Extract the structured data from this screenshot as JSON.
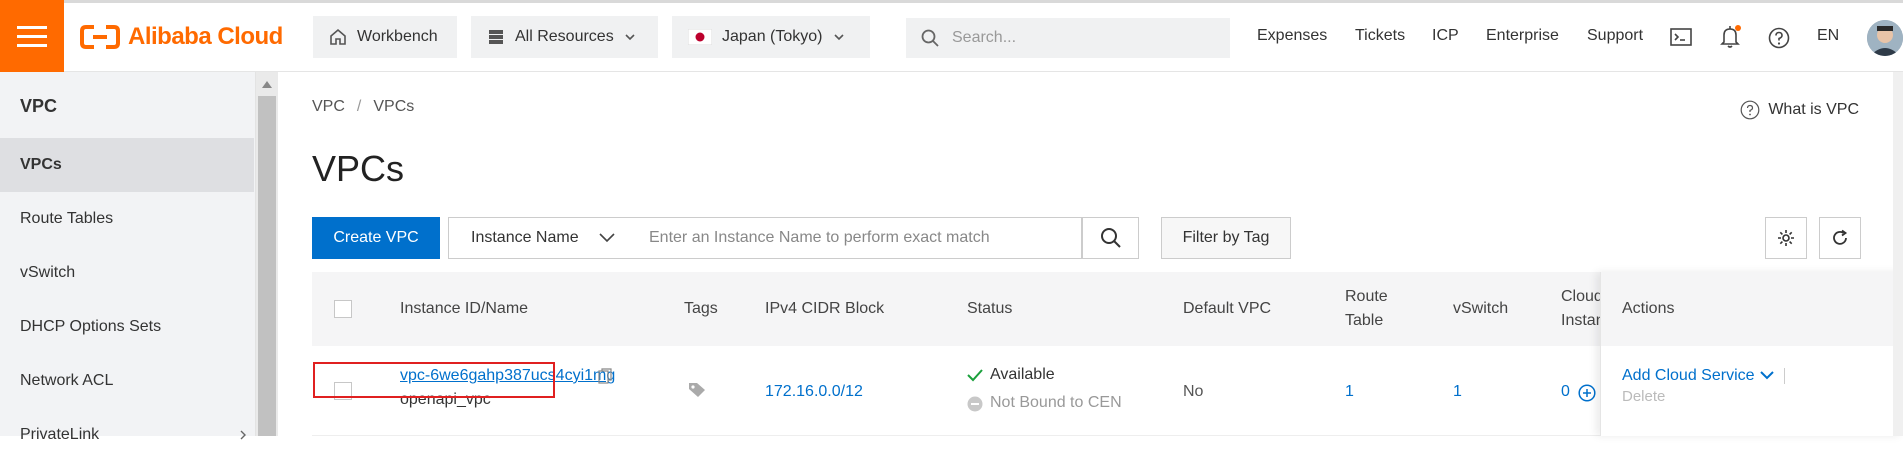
{
  "topbar": {
    "brand": "Alibaba Cloud",
    "workbench": "Workbench",
    "all_resources": "All Resources",
    "region": "Japan (Tokyo)",
    "search_placeholder": "Search...",
    "links": [
      "Expenses",
      "Tickets",
      "ICP",
      "Enterprise",
      "Support"
    ],
    "language": "EN",
    "accent_color": "#ff6a00",
    "notification_dot_color": "#ff6a00"
  },
  "sidebar": {
    "title": "VPC",
    "items": [
      {
        "label": "VPCs",
        "active": true
      },
      {
        "label": "Route Tables"
      },
      {
        "label": "vSwitch"
      },
      {
        "label": "DHCP Options Sets"
      },
      {
        "label": "Network ACL"
      },
      {
        "label": "PrivateLink"
      }
    ]
  },
  "main": {
    "breadcrumb": [
      "VPC",
      "VPCs"
    ],
    "breadcrumb_sep": "/",
    "help_link": "What is VPC",
    "page_title": "VPCs",
    "create_button": "Create VPC",
    "filter_select": "Instance Name",
    "filter_placeholder": "Enter an Instance Name to perform exact match",
    "filter_by_tag": "Filter by Tag",
    "primary_color": "#0070cc"
  },
  "table": {
    "headers": {
      "instance": "Instance ID/Name",
      "tags": "Tags",
      "cidr": "IPv4 CIDR Block",
      "status": "Status",
      "default_vpc": "Default VPC",
      "route_table_1": "Route",
      "route_table_2": "Table",
      "vswitch": "vSwitch",
      "cloud_1": "Cloud",
      "cloud_2": "Instan",
      "actions": "Actions"
    },
    "rows": [
      {
        "id": "vpc-6we6gahp387ucs4cyi1mg",
        "name": "openapi_vpc",
        "cidr": "172.16.0.0/12",
        "status": "Available",
        "cen_status": "Not Bound to CEN",
        "default_vpc": "No",
        "route_table": "1",
        "vswitch": "1",
        "cloud_instances": "0",
        "action_add": "Add Cloud Service",
        "action_delete": "Delete"
      }
    ]
  }
}
